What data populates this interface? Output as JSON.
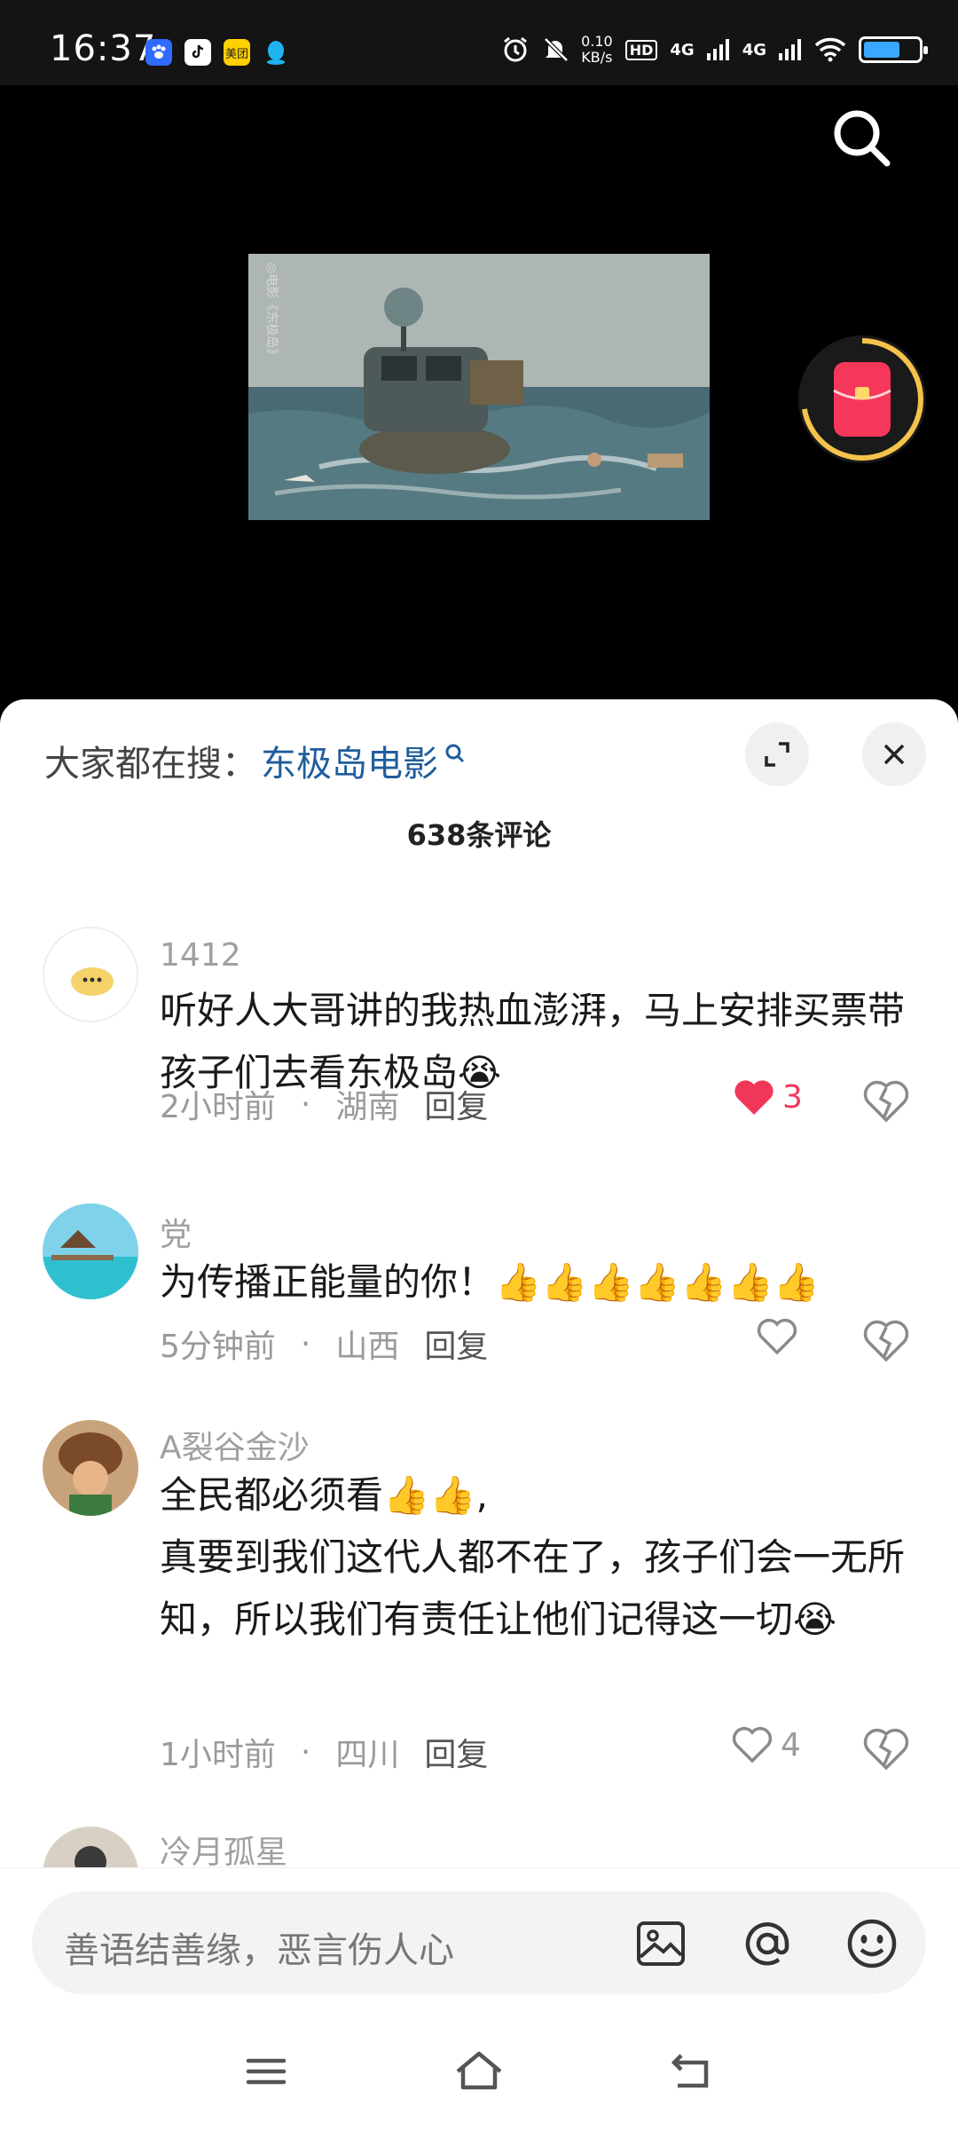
{
  "status_bar": {
    "time": "16:37",
    "net_speed_value": "0.10",
    "net_speed_unit": "KB/s",
    "hd_label": "HD",
    "sim1": "4G",
    "sim2": "4G",
    "meituan_label": "美团"
  },
  "search": {
    "prefix": "大家都在搜：",
    "keyword": "东极岛电影"
  },
  "comment_count": "638条评论",
  "comments": [
    {
      "username": "1412",
      "text": "听好人大哥讲的我热血澎湃，马上安排买票带孩子们去看东极岛😭",
      "time": "2小时前",
      "location": "湖南",
      "reply": "回复",
      "likes": "3",
      "liked": true
    },
    {
      "username": "党",
      "text": "为传播正能量的你！👍👍👍👍👍👍👍",
      "time": "5分钟前",
      "location": "山西",
      "reply": "回复",
      "likes": "",
      "liked": false
    },
    {
      "username": "A裂谷金沙",
      "text_line1": "全民都必须看👍👍,",
      "text_line2": "真要到我们这代人都不在了，孩子们会一无所知，所以我们有责任让他们记得这一切😭",
      "time": "1小时前",
      "location": "四川",
      "reply": "回复",
      "likes": "4",
      "liked": false
    },
    {
      "username": "冷月孤星"
    }
  ],
  "input": {
    "placeholder": "善语结善缘，恶言伤人心"
  },
  "colors": {
    "accent_blue": "#1f5d9c",
    "like_red": "#f2365a"
  }
}
